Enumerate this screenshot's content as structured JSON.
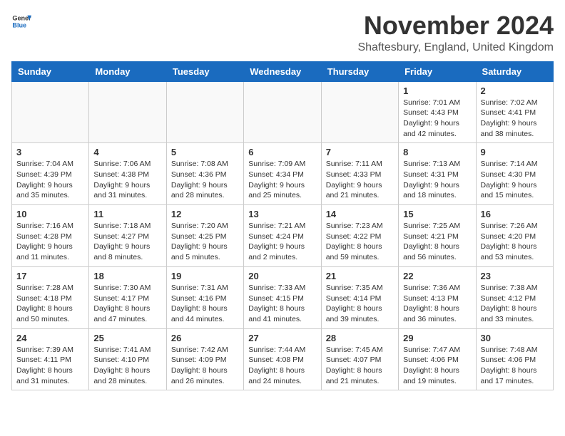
{
  "header": {
    "logo_general": "General",
    "logo_blue": "Blue",
    "month_year": "November 2024",
    "location": "Shaftesbury, England, United Kingdom"
  },
  "days_of_week": [
    "Sunday",
    "Monday",
    "Tuesday",
    "Wednesday",
    "Thursday",
    "Friday",
    "Saturday"
  ],
  "weeks": [
    [
      {
        "day": "",
        "info": ""
      },
      {
        "day": "",
        "info": ""
      },
      {
        "day": "",
        "info": ""
      },
      {
        "day": "",
        "info": ""
      },
      {
        "day": "",
        "info": ""
      },
      {
        "day": "1",
        "info": "Sunrise: 7:01 AM\nSunset: 4:43 PM\nDaylight: 9 hours\nand 42 minutes."
      },
      {
        "day": "2",
        "info": "Sunrise: 7:02 AM\nSunset: 4:41 PM\nDaylight: 9 hours\nand 38 minutes."
      }
    ],
    [
      {
        "day": "3",
        "info": "Sunrise: 7:04 AM\nSunset: 4:39 PM\nDaylight: 9 hours\nand 35 minutes."
      },
      {
        "day": "4",
        "info": "Sunrise: 7:06 AM\nSunset: 4:38 PM\nDaylight: 9 hours\nand 31 minutes."
      },
      {
        "day": "5",
        "info": "Sunrise: 7:08 AM\nSunset: 4:36 PM\nDaylight: 9 hours\nand 28 minutes."
      },
      {
        "day": "6",
        "info": "Sunrise: 7:09 AM\nSunset: 4:34 PM\nDaylight: 9 hours\nand 25 minutes."
      },
      {
        "day": "7",
        "info": "Sunrise: 7:11 AM\nSunset: 4:33 PM\nDaylight: 9 hours\nand 21 minutes."
      },
      {
        "day": "8",
        "info": "Sunrise: 7:13 AM\nSunset: 4:31 PM\nDaylight: 9 hours\nand 18 minutes."
      },
      {
        "day": "9",
        "info": "Sunrise: 7:14 AM\nSunset: 4:30 PM\nDaylight: 9 hours\nand 15 minutes."
      }
    ],
    [
      {
        "day": "10",
        "info": "Sunrise: 7:16 AM\nSunset: 4:28 PM\nDaylight: 9 hours\nand 11 minutes."
      },
      {
        "day": "11",
        "info": "Sunrise: 7:18 AM\nSunset: 4:27 PM\nDaylight: 9 hours\nand 8 minutes."
      },
      {
        "day": "12",
        "info": "Sunrise: 7:20 AM\nSunset: 4:25 PM\nDaylight: 9 hours\nand 5 minutes."
      },
      {
        "day": "13",
        "info": "Sunrise: 7:21 AM\nSunset: 4:24 PM\nDaylight: 9 hours\nand 2 minutes."
      },
      {
        "day": "14",
        "info": "Sunrise: 7:23 AM\nSunset: 4:22 PM\nDaylight: 8 hours\nand 59 minutes."
      },
      {
        "day": "15",
        "info": "Sunrise: 7:25 AM\nSunset: 4:21 PM\nDaylight: 8 hours\nand 56 minutes."
      },
      {
        "day": "16",
        "info": "Sunrise: 7:26 AM\nSunset: 4:20 PM\nDaylight: 8 hours\nand 53 minutes."
      }
    ],
    [
      {
        "day": "17",
        "info": "Sunrise: 7:28 AM\nSunset: 4:18 PM\nDaylight: 8 hours\nand 50 minutes."
      },
      {
        "day": "18",
        "info": "Sunrise: 7:30 AM\nSunset: 4:17 PM\nDaylight: 8 hours\nand 47 minutes."
      },
      {
        "day": "19",
        "info": "Sunrise: 7:31 AM\nSunset: 4:16 PM\nDaylight: 8 hours\nand 44 minutes."
      },
      {
        "day": "20",
        "info": "Sunrise: 7:33 AM\nSunset: 4:15 PM\nDaylight: 8 hours\nand 41 minutes."
      },
      {
        "day": "21",
        "info": "Sunrise: 7:35 AM\nSunset: 4:14 PM\nDaylight: 8 hours\nand 39 minutes."
      },
      {
        "day": "22",
        "info": "Sunrise: 7:36 AM\nSunset: 4:13 PM\nDaylight: 8 hours\nand 36 minutes."
      },
      {
        "day": "23",
        "info": "Sunrise: 7:38 AM\nSunset: 4:12 PM\nDaylight: 8 hours\nand 33 minutes."
      }
    ],
    [
      {
        "day": "24",
        "info": "Sunrise: 7:39 AM\nSunset: 4:11 PM\nDaylight: 8 hours\nand 31 minutes."
      },
      {
        "day": "25",
        "info": "Sunrise: 7:41 AM\nSunset: 4:10 PM\nDaylight: 8 hours\nand 28 minutes."
      },
      {
        "day": "26",
        "info": "Sunrise: 7:42 AM\nSunset: 4:09 PM\nDaylight: 8 hours\nand 26 minutes."
      },
      {
        "day": "27",
        "info": "Sunrise: 7:44 AM\nSunset: 4:08 PM\nDaylight: 8 hours\nand 24 minutes."
      },
      {
        "day": "28",
        "info": "Sunrise: 7:45 AM\nSunset: 4:07 PM\nDaylight: 8 hours\nand 21 minutes."
      },
      {
        "day": "29",
        "info": "Sunrise: 7:47 AM\nSunset: 4:06 PM\nDaylight: 8 hours\nand 19 minutes."
      },
      {
        "day": "30",
        "info": "Sunrise: 7:48 AM\nSunset: 4:06 PM\nDaylight: 8 hours\nand 17 minutes."
      }
    ]
  ]
}
